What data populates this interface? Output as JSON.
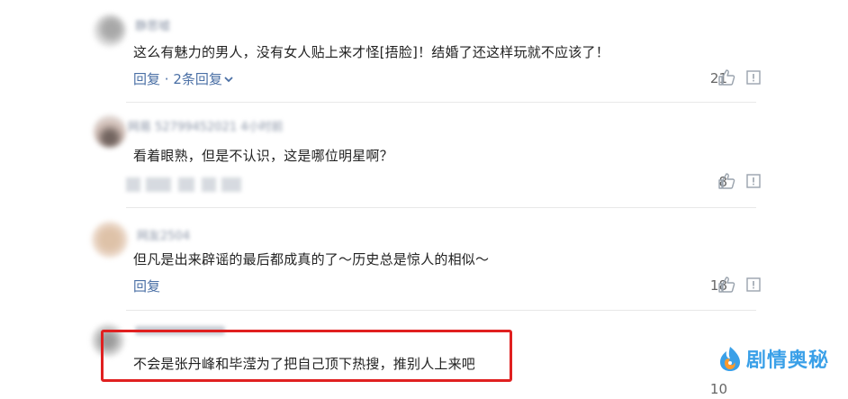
{
  "comments": [
    {
      "username": "静思嘘",
      "text": "这么有魅力的男人，没有女人贴上来才怪[捂脸]！结婚了还这样玩就不应该了！",
      "reply_label": "回复",
      "separator": "·",
      "replies_label": "2条回复",
      "likes": "21"
    },
    {
      "username": "网易 52799452021 4小时前",
      "text": "看着眼熟，但是不认识，这是哪位明星啊？",
      "likes": "8"
    },
    {
      "username": "网友2504",
      "text": "但凡是出来辟谣的最后都成真的了～历史总是惊人的相似～",
      "reply_label": "回复",
      "likes": "18"
    },
    {
      "text": "不会是张丹峰和毕滢为了把自己顶下热搜，推别人上来吧",
      "likes": "10"
    }
  ],
  "watermark": {
    "text": "剧情奥秘",
    "color": "#3aa0e8"
  },
  "colors": {
    "highlight": "#e02020",
    "link": "#4a6fa5",
    "like_icon": "#9aa3ad"
  },
  "icons": {
    "like": "thumbs-up-icon",
    "report": "report-icon",
    "expand": "chevron-down-icon"
  }
}
